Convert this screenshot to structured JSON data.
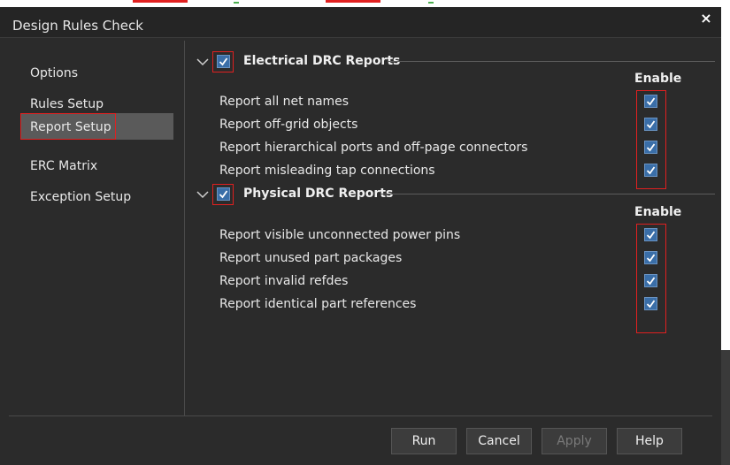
{
  "window": {
    "title": "Design Rules Check",
    "close_glyph": "×"
  },
  "sidebar": {
    "items": [
      {
        "label": "Options"
      },
      {
        "label": "Rules Setup"
      },
      {
        "label": "Report Setup",
        "selected": true
      },
      {
        "label": "ERC Matrix"
      },
      {
        "label": "Exception Setup"
      }
    ]
  },
  "electrical": {
    "header": "Electrical DRC Reports",
    "enabled": true,
    "column_label": "Enable",
    "rows": [
      {
        "label": "Report all net names",
        "checked": true
      },
      {
        "label": "Report off-grid objects",
        "checked": true
      },
      {
        "label": "Report hierarchical ports and off-page connectors",
        "checked": true
      },
      {
        "label": "Report misleading tap connections",
        "checked": true
      }
    ]
  },
  "physical": {
    "header": "Physical DRC Reports",
    "enabled": true,
    "column_label": "Enable",
    "rows": [
      {
        "label": "Report visible unconnected power pins",
        "checked": true
      },
      {
        "label": "Report unused part packages",
        "checked": true
      },
      {
        "label": "Report invalid refdes",
        "checked": true
      },
      {
        "label": "Report identical part references",
        "checked": true
      }
    ]
  },
  "buttons": {
    "run": "Run",
    "cancel": "Cancel",
    "apply": "Apply",
    "help": "Help"
  },
  "icons": {
    "check": "check-icon",
    "chevron": "chevron-down-icon",
    "close": "close-icon"
  },
  "colors": {
    "background": "#2b2b2b",
    "checkbox": "#3a6ea8",
    "highlight_border": "#e02020"
  }
}
